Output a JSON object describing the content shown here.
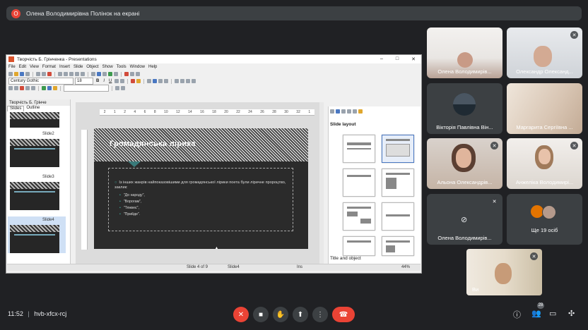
{
  "banner": {
    "initial": "О",
    "text": "Олена Володимирівна Полінок на екрані"
  },
  "window": {
    "title": "Творчість Б. Грінченка - Presentations",
    "controls": [
      "–",
      "□",
      "✕"
    ],
    "menu": [
      "File",
      "Edit",
      "View",
      "Format",
      "Insert",
      "Slide",
      "Object",
      "Show",
      "Tools",
      "Window",
      "Help"
    ],
    "font_name": "Century Gothic",
    "font_size": "18",
    "format_buttons": [
      "B",
      "I",
      "U"
    ],
    "panel_tab": "Творчість Б. Грінче",
    "tabs": [
      "Slides",
      "Outline"
    ],
    "thumb_labels": [
      "Slide2",
      "Slide3",
      "Slide4"
    ],
    "ruler_numbers": [
      "2",
      "1",
      "2",
      "4",
      "6",
      "8",
      "10",
      "12",
      "14",
      "16",
      "18",
      "20",
      "22",
      "24",
      "26",
      "28",
      "30",
      "32",
      "1"
    ],
    "slide": {
      "title": "Громадянська лірика",
      "bullet": "Із інших жанрів найпоказовішими для громадянської лірики поета були ліричне пророцтво, заклик:",
      "items": [
        "\"До народу\",",
        "\"Ворогам\",",
        "\"Тяжкеє\",",
        "\"Прийде\"."
      ]
    },
    "layout_panel": {
      "title": "Slide layout",
      "bottom": "Title and object"
    },
    "status": {
      "slide": "Slide 4 of 9",
      "name": "Slide4",
      "mode": "Ins",
      "zoom": "44%"
    }
  },
  "tiles": [
    {
      "name": "Олена Володимирів...",
      "muted": true
    },
    {
      "name": "Олександр Олександ...",
      "muted": true
    },
    {
      "name": "Вікторія Павлівна Він...",
      "muted": false
    },
    {
      "name": "Маргарита Сергіївна ...",
      "muted": false
    },
    {
      "name": "Альона Олександрів...",
      "muted": true
    },
    {
      "name": "Анжеліка Володимирі...",
      "muted": true
    },
    {
      "name": "Олена Володимирів...",
      "muted": true
    },
    {
      "name": "Ще 19 осіб",
      "muted": false
    }
  ],
  "self_view": {
    "name": "Ви"
  },
  "bottom": {
    "time": "11:52",
    "separator": "|",
    "meeting_code": "hvb-xfcx-rcj",
    "participants_count": "28"
  },
  "colors": {
    "end_call": "#ea4335",
    "mic_muted": "#ea4335",
    "background": "#202124",
    "tile": "#3c4043"
  }
}
